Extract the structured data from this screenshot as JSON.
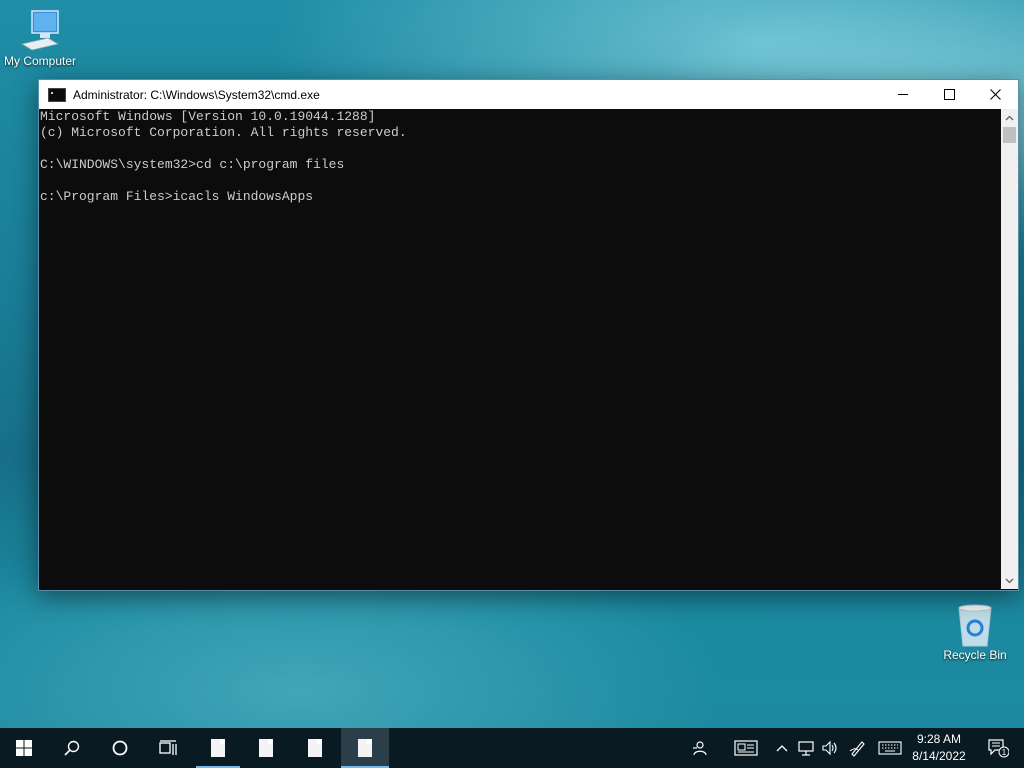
{
  "desktop": {
    "icons": [
      {
        "label": "My Computer",
        "icon": "computer-icon"
      },
      {
        "label": "Recycle Bin",
        "icon": "recycle-bin-icon"
      }
    ]
  },
  "window": {
    "title": "Administrator: C:\\Windows\\System32\\cmd.exe",
    "controls": {
      "minimize": "minimize-icon",
      "maximize": "maximize-icon",
      "close": "close-icon"
    },
    "console_lines": [
      "Microsoft Windows [Version 10.0.19044.1288]",
      "(c) Microsoft Corporation. All rights reserved.",
      "",
      "C:\\WINDOWS\\system32>cd c:\\program files",
      "",
      "c:\\Program Files>icacls WindowsApps"
    ]
  },
  "taskbar": {
    "start": "windows-logo-icon",
    "search": "search-icon",
    "cortana": "cortana-circle-icon",
    "task_view": "task-view-icon",
    "apps": [
      "document-icon",
      "document-icon",
      "document-icon",
      "document-icon"
    ],
    "tray": [
      "people-icon",
      "news-icon",
      "chevron-up-icon",
      "network-icon",
      "volume-icon",
      "pen-icon",
      "keyboard-icon"
    ],
    "clock": {
      "time": "9:28 AM",
      "date": "8/14/2022"
    },
    "notifications": {
      "count": "1"
    }
  },
  "colors": {
    "console_bg": "#0c0c0c",
    "console_text": "#cccccc",
    "taskbar_bg": "#0a1a22",
    "accent": "#76b9ed"
  }
}
